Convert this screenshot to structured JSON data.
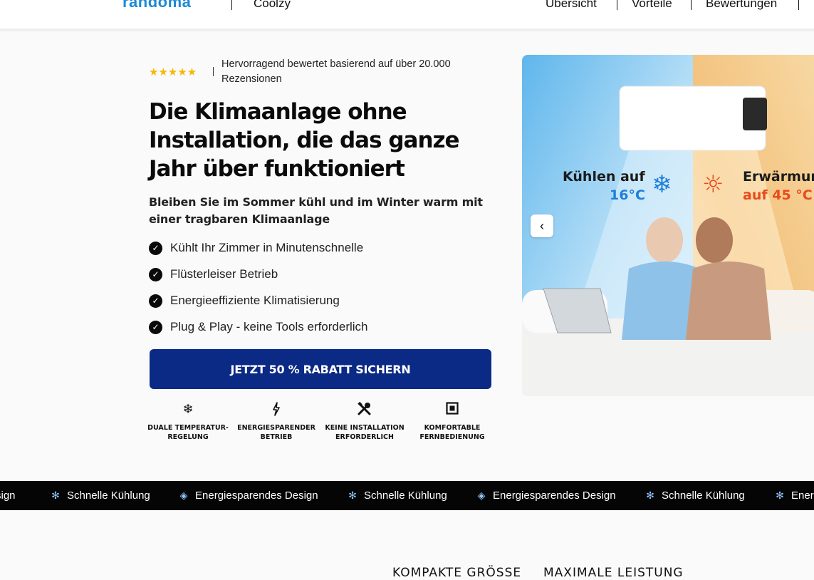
{
  "header": {
    "brand": "randoma",
    "brand_sub": "Coolzy",
    "nav": [
      "Übersicht",
      "Vorteile",
      "Bewertungen"
    ]
  },
  "hero": {
    "stars": "★★★★★",
    "rating_text": "Hervorragend bewertet basierend auf über 20.000 Rezensionen",
    "headline": "Die Klimaanlage ohne Installation, die das ganze Jahr über funktioniert",
    "subline": "Bleiben Sie im Sommer kühl und im Winter warm mit einer tragbaren Klimaanlage",
    "features": [
      "Kühlt Ihr Zimmer in Minutenschnelle",
      "Flüsterleiser Betrieb",
      "Energieeffiziente Klimatisierung",
      "Plug & Play - keine Tools erforderlich"
    ],
    "cta_label": "JETZT 50 % RABATT SICHERN",
    "benefits": [
      {
        "icon": "snowflake-icon",
        "label": "DUALE TEMPERATUR-REGELUNG"
      },
      {
        "icon": "lightning-icon",
        "label": "ENERGIESPARENDER BETRIEB"
      },
      {
        "icon": "tools-icon",
        "label": "KEINE INSTALLATION ERFORDERLICH"
      },
      {
        "icon": "remote-icon",
        "label": "KOMFORTABLE FERNBEDIENUNG"
      }
    ]
  },
  "image": {
    "cool_line1": "Kühlen auf",
    "cool_temp": "16°C",
    "warm_line1": "Erwärmun",
    "warm_temp": "auf 45 °C",
    "prev_label": "‹",
    "colors": {
      "cool": "#7fc8f2",
      "warm": "#f5c27a",
      "cool_text": "#1e7fd8",
      "warm_text": "#e84a1c"
    }
  },
  "marquee": {
    "items": [
      "sign",
      "Schnelle Kühlung",
      "Energiesparendes Design",
      "Schnelle Kühlung",
      "Energiesparendes Design",
      "Schnelle Kühlung",
      "Ener"
    ]
  },
  "bottom": {
    "headings": [
      "KOMPAKTE GRÖSSE",
      "MAXIMALE LEISTUNG"
    ]
  },
  "colors": {
    "cta": "#0b2a85",
    "brand": "#1a8ad6",
    "stars": "#f6b800"
  }
}
